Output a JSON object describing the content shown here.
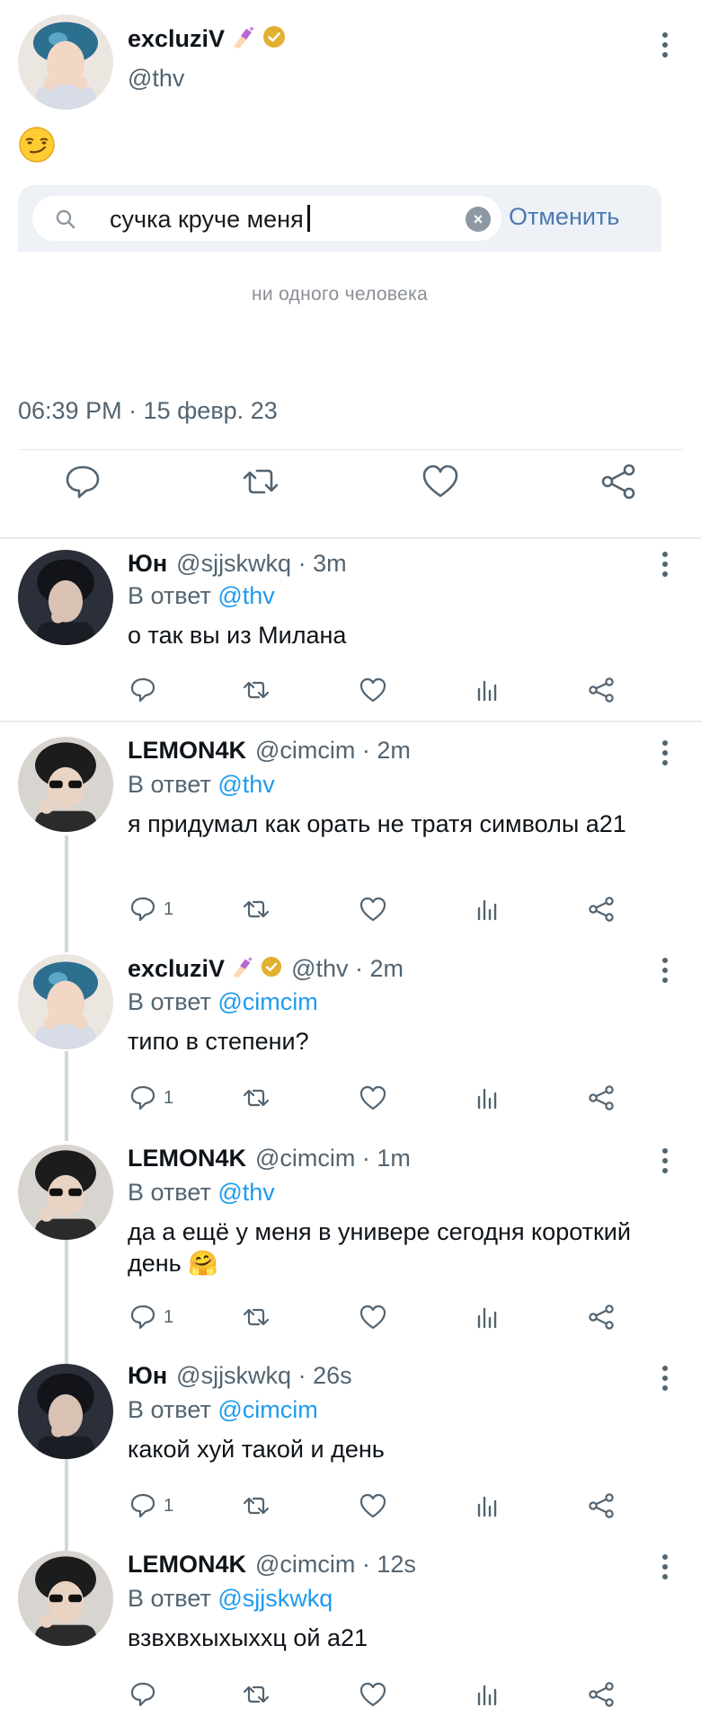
{
  "main_tweet": {
    "author_name": "excluziV",
    "handle": "@thv",
    "emoji": "😏",
    "embedded_screenshot": {
      "search_text": "сучка круче меня",
      "cancel_label": "Отменить",
      "result_text": "ни одного человека"
    },
    "timestamp": "06:39 PM · 15 февр. 23",
    "actions": [
      "reply-icon",
      "retweet-icon",
      "like-icon",
      "share-icon"
    ]
  },
  "reply_prefix": "В ответ",
  "replies": [
    {
      "name": "Юн",
      "handle": "@sjjskwkq · 3m",
      "reply_to": "@thv",
      "text": "о так вы из Милана",
      "reply_count": "",
      "verified": false
    },
    {
      "name": "LEMON4K",
      "handle": "@cimcim · 2m",
      "reply_to": "@thv",
      "text": "я придумал как орать не тратя  символы а21",
      "reply_count": "1",
      "verified": false
    },
    {
      "name": "excluziV",
      "handle": "@thv · 2m",
      "reply_to": "@cimcim",
      "text": "типо в степени?",
      "reply_count": "1",
      "verified": true
    },
    {
      "name": "LEMON4K",
      "handle": "@cimcim · 1m",
      "reply_to": "@thv",
      "text": "да  а ещё у меня в универе сегодня короткий день 🤗",
      "reply_count": "1",
      "verified": false
    },
    {
      "name": "Юн",
      "handle": "@sjjskwkq · 26s",
      "reply_to": "@cimcim",
      "text": "какой хуй такой и день",
      "reply_count": "1",
      "verified": false
    },
    {
      "name": "LEMON4K",
      "handle": "@cimcim · 12s",
      "reply_to": "@sjjskwkq",
      "text": "взвхвхыхыххц ой а21",
      "reply_count": "",
      "verified": false
    }
  ],
  "colors": {
    "link": "#1d9bf0",
    "secondary_text": "#536471",
    "verified_badge": "#e2b030",
    "divider": "#e7e9ea"
  }
}
